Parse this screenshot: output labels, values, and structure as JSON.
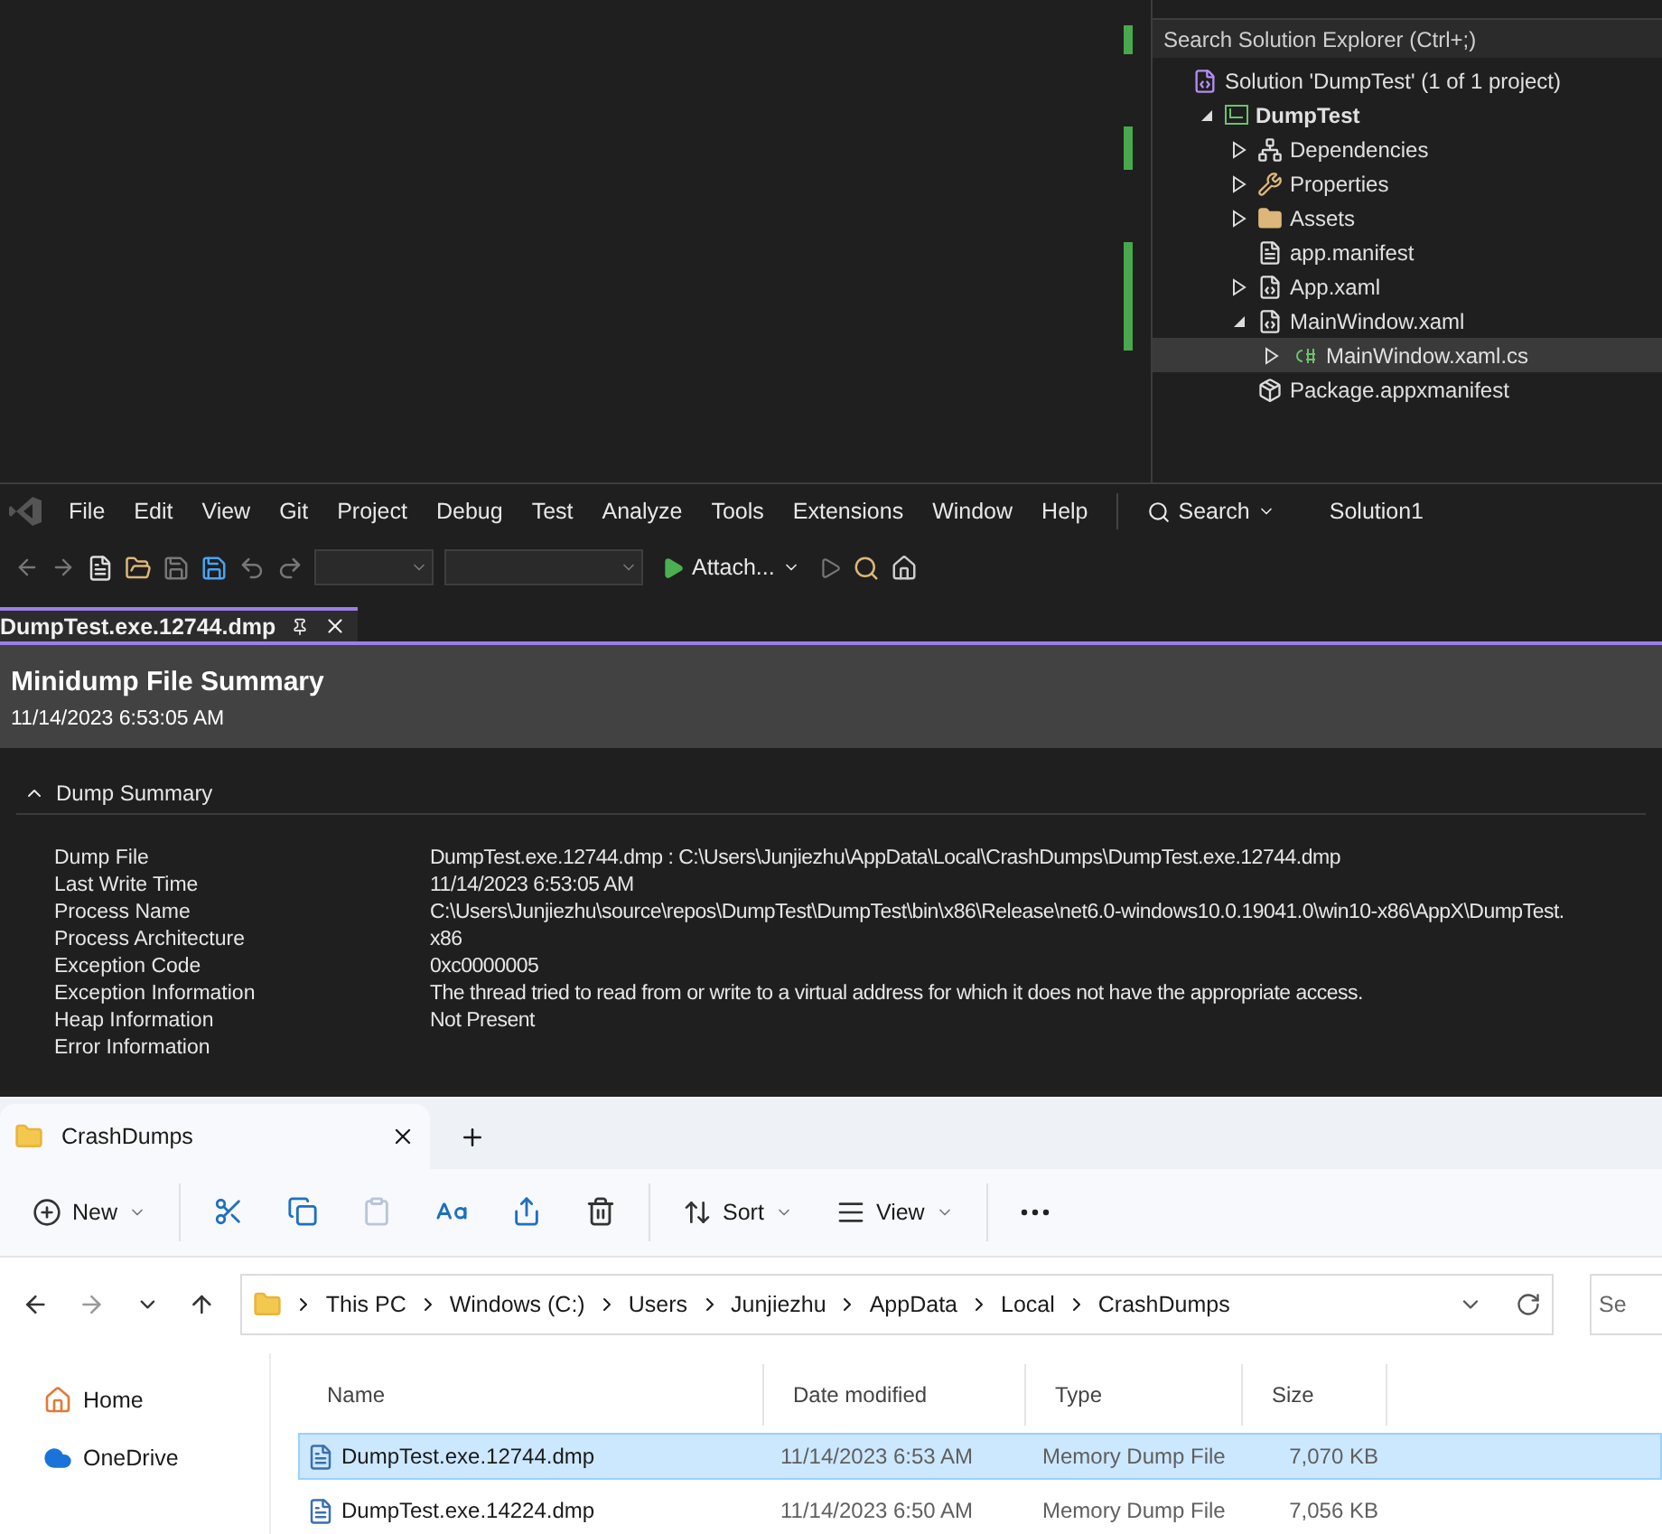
{
  "solution_explorer": {
    "search": {
      "placeholder": "Search Solution Explorer (Ctrl+;)"
    },
    "tree": [
      {
        "label": "Solution 'DumpTest' (1 of 1 project)",
        "kind": "solution",
        "selected": false,
        "children": [
          {
            "label": "DumpTest",
            "kind": "project",
            "expanded": true,
            "selected": false,
            "children": [
              {
                "label": "Dependencies",
                "kind": "dependencies",
                "expanded": false,
                "selected": false
              },
              {
                "label": "Properties",
                "kind": "properties",
                "expanded": false,
                "selected": false
              },
              {
                "label": "Assets",
                "kind": "folder",
                "expanded": false,
                "selected": false
              },
              {
                "label": "app.manifest",
                "kind": "manifest",
                "selected": false
              },
              {
                "label": "App.xaml",
                "kind": "xaml",
                "expanded": false,
                "selected": false
              },
              {
                "label": "MainWindow.xaml",
                "kind": "xaml",
                "expanded": true,
                "selected": false,
                "children": [
                  {
                    "label": "MainWindow.xaml.cs",
                    "kind": "csharp",
                    "expanded": false,
                    "selected": true
                  }
                ]
              },
              {
                "label": "Package.appxmanifest",
                "kind": "package",
                "selected": false
              }
            ]
          }
        ]
      }
    ]
  },
  "menu_bar": {
    "items": [
      "File",
      "Edit",
      "View",
      "Git",
      "Project",
      "Debug",
      "Test",
      "Analyze",
      "Tools",
      "Extensions",
      "Window",
      "Help"
    ],
    "search": "Search",
    "solution_name": "Solution1"
  },
  "toolbar": {
    "attach_button": "Attach..."
  },
  "document_tabs": [
    {
      "label": "DumpTest.exe.12744.dmp",
      "selected": true
    }
  ],
  "summary": {
    "title": "Minidump File Summary",
    "timestamp": "11/14/2023 6:53:05 AM",
    "section": {
      "title": "Dump Summary",
      "expanded": true,
      "rows": [
        {
          "label": "Dump File",
          "value": "DumpTest.exe.12744.dmp : C:\\Users\\Junjiezhu\\AppData\\Local\\CrashDumps\\DumpTest.exe.12744.dmp"
        },
        {
          "label": "Last Write Time",
          "value": "11/14/2023 6:53:05 AM"
        },
        {
          "label": "Process Name",
          "value": "C:\\Users\\Junjiezhu\\source\\repos\\DumpTest\\DumpTest\\bin\\x86\\Release\\net6.0-windows10.0.19041.0\\win10-x86\\AppX\\DumpTest."
        },
        {
          "label": "Process Architecture",
          "value": "x86"
        },
        {
          "label": "Exception Code",
          "value": "0xc0000005"
        },
        {
          "label": "Exception Information",
          "value": "The thread tried to read from or write to a virtual address for which it does not have the appropriate access."
        },
        {
          "label": "Heap Information",
          "value": "Not Present"
        },
        {
          "label": "Error Information"
        }
      ]
    }
  },
  "file_explorer": {
    "tabs": [
      {
        "label": "CrashDumps",
        "selected": true
      }
    ],
    "commands": [
      {
        "kind": "new",
        "label": "New"
      },
      {
        "kind": "cut"
      },
      {
        "kind": "copy"
      },
      {
        "kind": "paste",
        "disabled": true
      },
      {
        "kind": "rename"
      },
      {
        "kind": "share"
      },
      {
        "kind": "delete"
      },
      {
        "kind": "sort",
        "label": "Sort"
      },
      {
        "kind": "view",
        "label": "View"
      },
      {
        "kind": "more"
      }
    ],
    "breadcrumb": [
      "This PC",
      "Windows (C:)",
      "Users",
      "Junjiezhu",
      "AppData",
      "Local",
      "CrashDumps"
    ],
    "search": {
      "placeholder": "Se"
    },
    "nav_pane": [
      {
        "label": "Home",
        "kind": "home"
      },
      {
        "label": "OneDrive",
        "kind": "cloud"
      }
    ],
    "columns": [
      "Name",
      "Date modified",
      "Type",
      "Size"
    ],
    "rows": [
      {
        "name": "DumpTest.exe.12744.dmp",
        "date": "11/14/2023 6:53 AM",
        "type": "Memory Dump File",
        "size": "7,070 KB",
        "selected": true
      },
      {
        "name": "DumpTest.exe.14224.dmp",
        "date": "11/14/2023 6:50 AM",
        "type": "Memory Dump File",
        "size": "7,056 KB",
        "selected": false
      }
    ]
  }
}
